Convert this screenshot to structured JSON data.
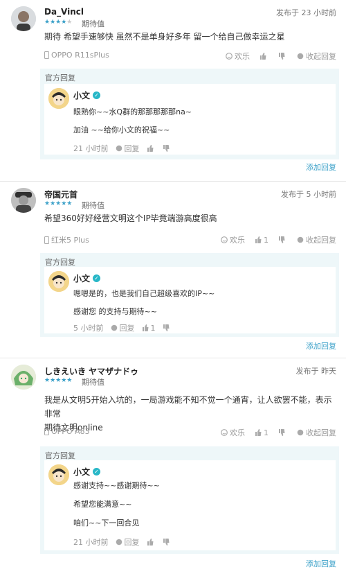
{
  "colors": {
    "accent": "#3aa0c8",
    "reply_bg": "#eef7f9",
    "muted": "#999999"
  },
  "reviews": [
    {
      "username": "Da_Vincl",
      "rating": 4,
      "rating_label": "期待值",
      "posted": "发布于 23 小时前",
      "content": [
        "期待 希望手速够快 虽然不是单身好多年 留一个给自己做幸运之星"
      ],
      "device": "OPPO R11sPlus",
      "funny_label": "欢乐",
      "upvotes": "",
      "downvotes": "",
      "collapse_label": "收起回复",
      "official_label": "官方回复",
      "reply": {
        "name": "小文",
        "lines": [
          "眼熟你~~水Q群的那那那那那na~",
          "加油 ~~给你小文的祝福~~"
        ],
        "time": "21 小时前",
        "reply_label": "回复",
        "upvotes": ""
      },
      "add_reply_label": "添加回复"
    },
    {
      "username": "帝国元首",
      "rating": 5,
      "rating_label": "期待值",
      "posted": "发布于 5 小时前",
      "content": [
        "希望360好好经营文明这个IP毕竟端游高度很高"
      ],
      "device": "红米5 Plus",
      "funny_label": "欢乐",
      "upvotes": "1",
      "downvotes": "",
      "collapse_label": "收起回复",
      "official_label": "官方回复",
      "reply": {
        "name": "小文",
        "lines": [
          "嗯嗯是的，也是我们自己超级喜欢的IP~~",
          "感谢您 的支持与期待~~"
        ],
        "time": "5 小时前",
        "reply_label": "回复",
        "upvotes": "1"
      },
      "add_reply_label": "添加回复"
    },
    {
      "username": "しきえいき ヤマザナドゥ",
      "rating": 5,
      "rating_label": "期待值",
      "posted": "发布于 昨天",
      "content": [
        "我是从文明5开始入坑的，一局游戏能不知不觉一个通宵，让人欲罢不能，表示非常",
        "期待文明online"
      ],
      "device": "OPPO A83",
      "funny_label": "欢乐",
      "upvotes": "1",
      "downvotes": "",
      "collapse_label": "收起回复",
      "official_label": "官方回复",
      "reply": {
        "name": "小文",
        "lines": [
          "感谢支持~~感谢期待~~",
          "希望您能满意~~",
          "咱们~~下一回合见"
        ],
        "time": "21 小时前",
        "reply_label": "回复",
        "upvotes": ""
      },
      "add_reply_label": "添加回复"
    }
  ]
}
